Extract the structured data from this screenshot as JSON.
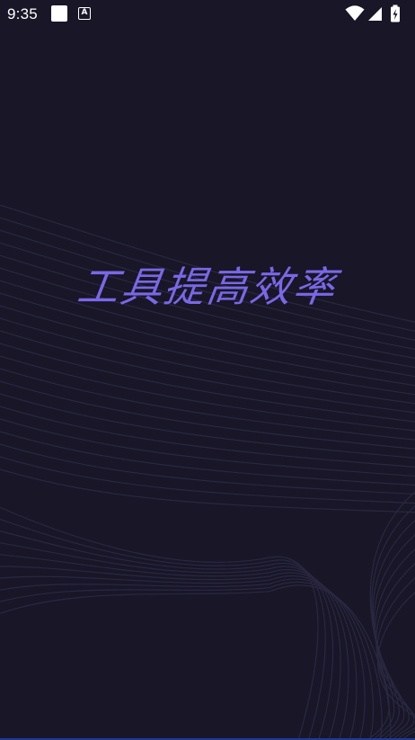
{
  "status_bar": {
    "time": "9:35",
    "notification_letter": "A",
    "icons": [
      "wifi-icon",
      "cell-signal-icon",
      "battery-charging-icon"
    ]
  },
  "splash": {
    "slogan": "工具提高效率"
  },
  "colors": {
    "background": "#181627",
    "slogan": "#7a67e6",
    "wave_lines": "#2a2840",
    "status_text": "#ffffff"
  }
}
